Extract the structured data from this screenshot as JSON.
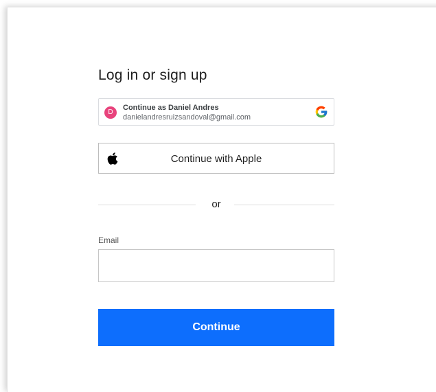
{
  "dialog": {
    "title": "Log in or sign up"
  },
  "google_account": {
    "avatar_initial": "D",
    "avatar_color": "#e8437c",
    "name_label": "Continue as Daniel Andres",
    "email": "danielandresruizsandoval@gmail.com",
    "icon": "google-icon"
  },
  "apple": {
    "label": "Continue with Apple",
    "icon": "apple-icon"
  },
  "divider": {
    "text": "or"
  },
  "email_field": {
    "label": "Email",
    "value": "",
    "placeholder": ""
  },
  "submit": {
    "label": "Continue",
    "color": "#0d6efd"
  }
}
